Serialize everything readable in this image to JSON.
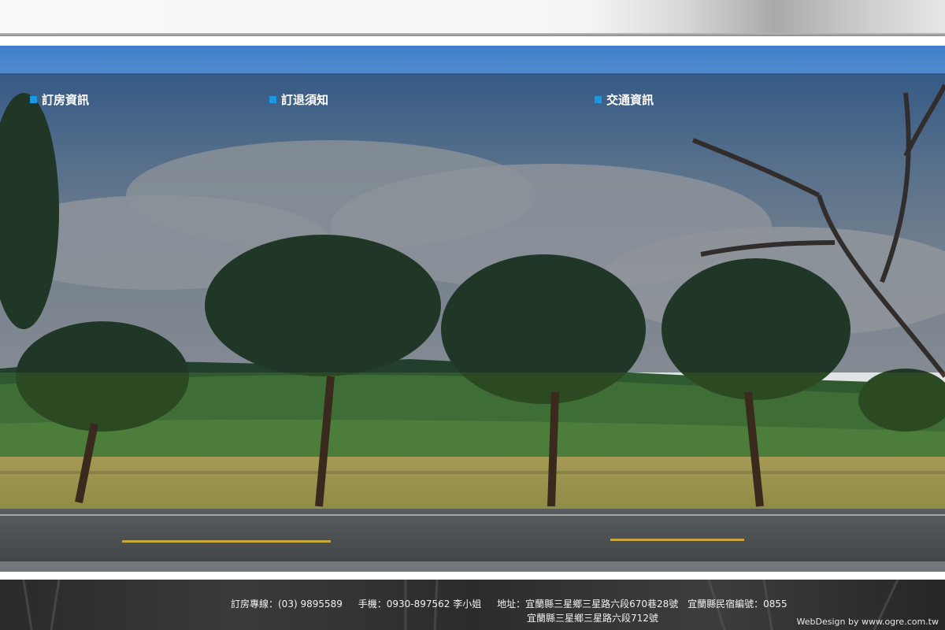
{
  "nav": {
    "items": [
      {
        "label": "訂房資訊"
      },
      {
        "label": "訂退須知"
      },
      {
        "label": "交通資訊"
      }
    ]
  },
  "footer": {
    "phone": "訂房專線：(03) 9895589",
    "mobile": "手機：0930-897562 李小姐",
    "address": "地址：宜蘭縣三星鄉三星路六段670巷28號",
    "license": "宜蘭縣民宿編號：0855",
    "address2": "宜蘭縣三星鄉三星路六段712號",
    "credit": "WebDesign by www.ogre.com.tw"
  },
  "colors": {
    "accent": "#1e96e0",
    "overlay": "#141e2d"
  }
}
